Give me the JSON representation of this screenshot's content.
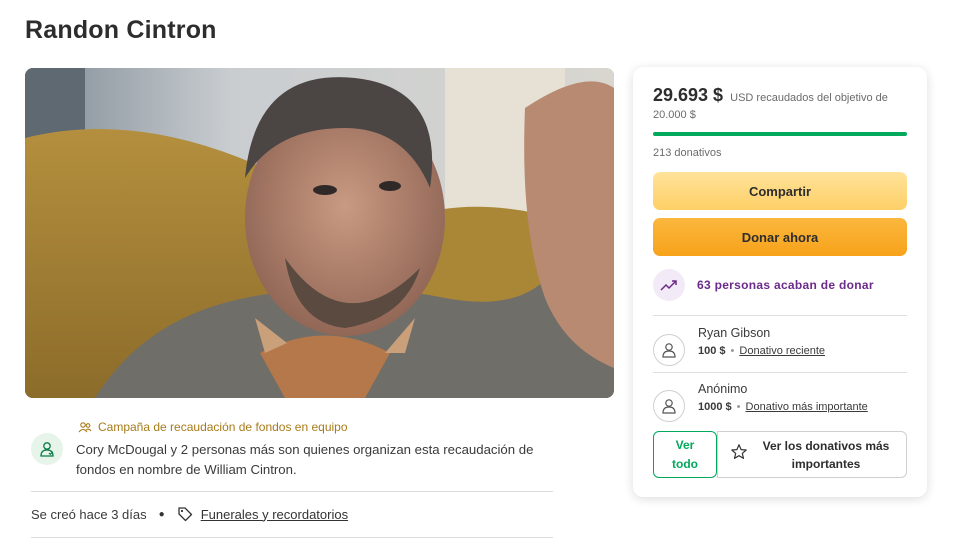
{
  "page": {
    "title": "Randon Cintron"
  },
  "campaign": {
    "team_tag": "Campaña de recaudación de fondos en equipo",
    "organizer_text": "Cory McDougal y 2 personas más son quienes organizan esta recaudación de fondos en nombre de William Cintron.",
    "created": "Se creó hace 3 días",
    "category": "Funerales y recordatorios"
  },
  "card": {
    "amount": "29.693 $",
    "amount_suffix": "USD recaudados del objetivo de 20.000 $",
    "progress_fraction": 1.0,
    "donations_count": "213 donativos",
    "share_label": "Compartir",
    "donate_label": "Donar ahora",
    "recent_text": "63 personas acaban de donar",
    "donors": [
      {
        "name": "Ryan Gibson",
        "amount": "100 $",
        "label": "Donativo reciente"
      },
      {
        "name": "Anónimo",
        "amount": "1000 $",
        "label": "Donativo más importante"
      }
    ],
    "see_all_label": "Ver todo",
    "top_donations_label": "Ver los donativos más importantes"
  },
  "colors": {
    "accent_green": "#02a95c",
    "share_yellow": "#fdcf66",
    "donate_orange": "#f7a21a",
    "purple_text": "#6c2a8a"
  }
}
